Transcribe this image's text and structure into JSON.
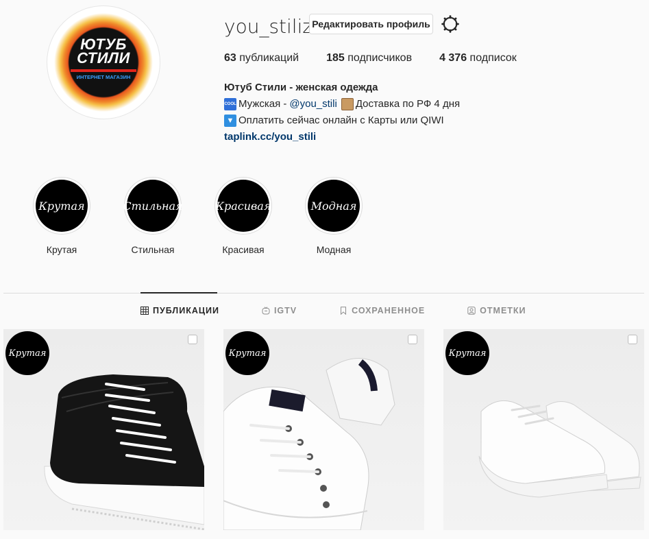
{
  "profile": {
    "avatar_title": "ЮТУБ\nСТИЛИ",
    "avatar_subtitle": "ИНТЕРНЕТ МАГАЗИН",
    "username": "you_stiliz",
    "edit_button": "Редактировать профиль",
    "settings_icon": "gear-icon"
  },
  "stats": {
    "posts_count": "63",
    "posts_label": " публикаций",
    "followers_count": "185",
    "followers_label": " подписчиков",
    "following_count": "4 376",
    "following_label": " подписок"
  },
  "bio": {
    "name": "Ютуб Стили - женская одежда",
    "line2_prefix": "Мужская -",
    "line2_mention": "@you_stili",
    "line2_suffix": "Доставка по РФ 4 дня",
    "line3": "Оплатить сейчас онлайн с Карты или QIWI",
    "link": "taplink.cc/you_stili",
    "cool_emoji_text": "COOL"
  },
  "highlights": [
    {
      "title": "Крутая",
      "cover_text": "Крутая"
    },
    {
      "title": "Стильная",
      "cover_text": "Стильная"
    },
    {
      "title": "Красивая",
      "cover_text": "Красивая"
    },
    {
      "title": "Модная",
      "cover_text": "Модная"
    }
  ],
  "tabs": [
    {
      "label": "ПУБЛИКАЦИИ",
      "icon": "grid-icon",
      "active": true
    },
    {
      "label": "IGTV",
      "icon": "igtv-icon",
      "active": false
    },
    {
      "label": "СОХРАНЕННОЕ",
      "icon": "bookmark-icon",
      "active": false
    },
    {
      "label": "ОТМЕТКИ",
      "icon": "tagged-icon",
      "active": false
    }
  ],
  "posts": [
    {
      "badge": "Крутая",
      "image": "black-high-top-sneaker"
    },
    {
      "badge": "Крутая",
      "image": "white-platform-sneakers"
    },
    {
      "badge": "Крутая",
      "image": "white-wedge-sneakers"
    }
  ],
  "colors": {
    "background": "#fafafa",
    "text": "#262626",
    "secondary": "#8e8e8e",
    "link": "#00376b",
    "border": "#dbdbdb"
  }
}
